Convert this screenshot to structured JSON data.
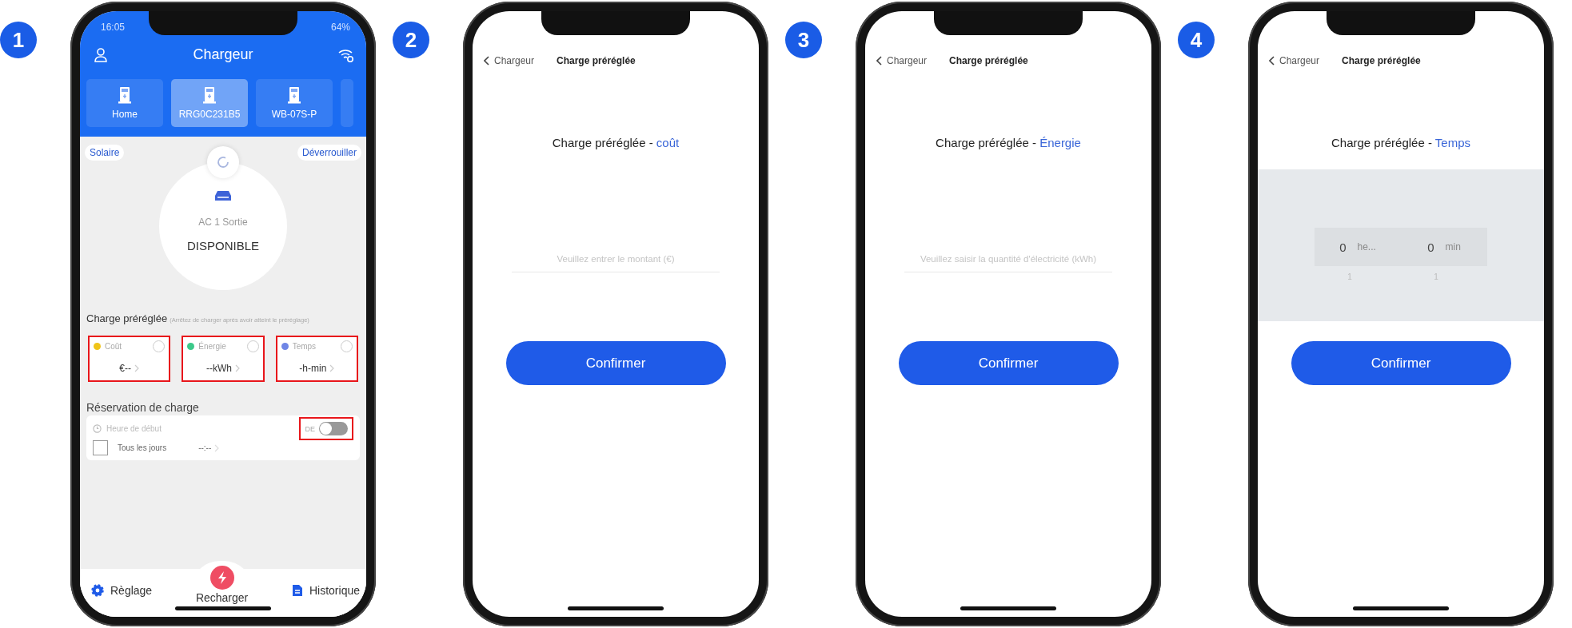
{
  "steps": [
    {
      "kind": "charger",
      "number": "1",
      "status_bar": {
        "time": "16:05",
        "battery": "64%"
      },
      "title": "Chargeur",
      "devices": [
        {
          "label": "Home",
          "selected": false
        },
        {
          "label": "RRG0C231B5",
          "selected": true
        },
        {
          "label": "WB-07S-P",
          "selected": false
        }
      ],
      "left_button": "Solaire",
      "right_button": "Déverrouiller",
      "connector": "AC 1 Sortie",
      "status": "DISPONIBLE",
      "preset": {
        "title": "Charge préréglée",
        "note": "(Arrêtez de charger après avoir atteint le préréglage)",
        "options": [
          {
            "label": "Coût",
            "value": "€--",
            "color": "#f0c419",
            "checked": false,
            "highlighted": true
          },
          {
            "label": "Énergie",
            "value": "--kWh",
            "color": "#3cc98a",
            "checked": false,
            "highlighted": true
          },
          {
            "label": "Temps",
            "value": "-h-min",
            "color": "#6f86e6",
            "checked": false,
            "highlighted": true
          }
        ]
      },
      "reservation": {
        "title": "Réservation de charge",
        "start_label": "Heure de début",
        "disabled": true,
        "toggle_label": "DE",
        "on": false,
        "toggle_highlighted": true,
        "daily_label": "Tous les jours",
        "checked": false,
        "time": "--:--"
      },
      "nav": [
        {
          "kind": "settings",
          "label": "Règlage"
        },
        {
          "kind": "charge",
          "label": "Recharger"
        },
        {
          "kind": "history",
          "label": "Historique"
        }
      ]
    },
    {
      "kind": "input",
      "number": "2",
      "back": "Chargeur",
      "title": "Charge préréglée",
      "heading": "Charge préréglée - ",
      "heading_accent": "coût",
      "placeholder": "Veuillez entrer le montant (€)",
      "button": "Confirmer"
    },
    {
      "kind": "input",
      "number": "3",
      "back": "Chargeur",
      "title": "Charge préréglée",
      "heading": "Charge préréglée - ",
      "heading_accent": "Énergie",
      "placeholder": "Veuillez saisir la quantité d'électricité (kWh)",
      "button": "Confirmer"
    },
    {
      "kind": "time",
      "number": "4",
      "back": "Chargeur",
      "title": "Charge préréglée",
      "heading": "Charge préréglée - ",
      "heading_accent": "Temps",
      "picker": [
        {
          "value": "0",
          "unit": "he...",
          "next": "1"
        },
        {
          "value": "0",
          "unit": "min",
          "next": "1"
        }
      ],
      "button": "Confirmer"
    }
  ]
}
